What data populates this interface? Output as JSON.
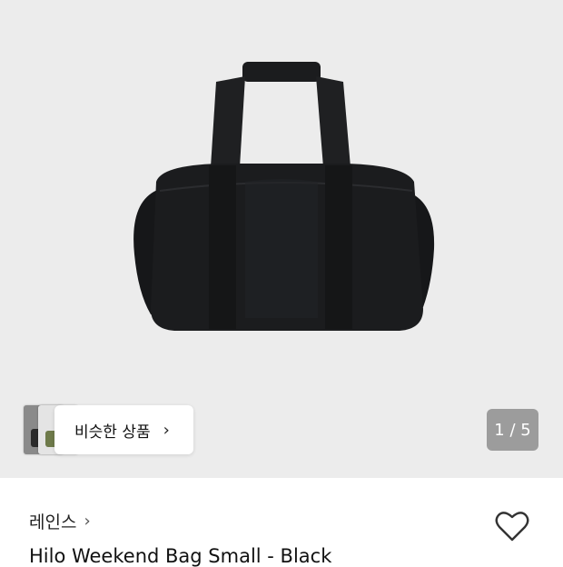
{
  "image": {
    "background": "#ececec",
    "similar": {
      "label": "비슷한 상품",
      "chevron": "›"
    },
    "page_indicator": "1 / 5"
  },
  "product": {
    "brand": "레인스",
    "brand_chevron": "›",
    "title": "Hilo Weekend Bag Small - Black"
  },
  "icons": {
    "wishlist": "heart-outline-icon",
    "image_subject": "black-duffel-bag"
  },
  "colors": {
    "bag": "#1b1c1e",
    "indicator_bg": "#9c9c9c"
  }
}
